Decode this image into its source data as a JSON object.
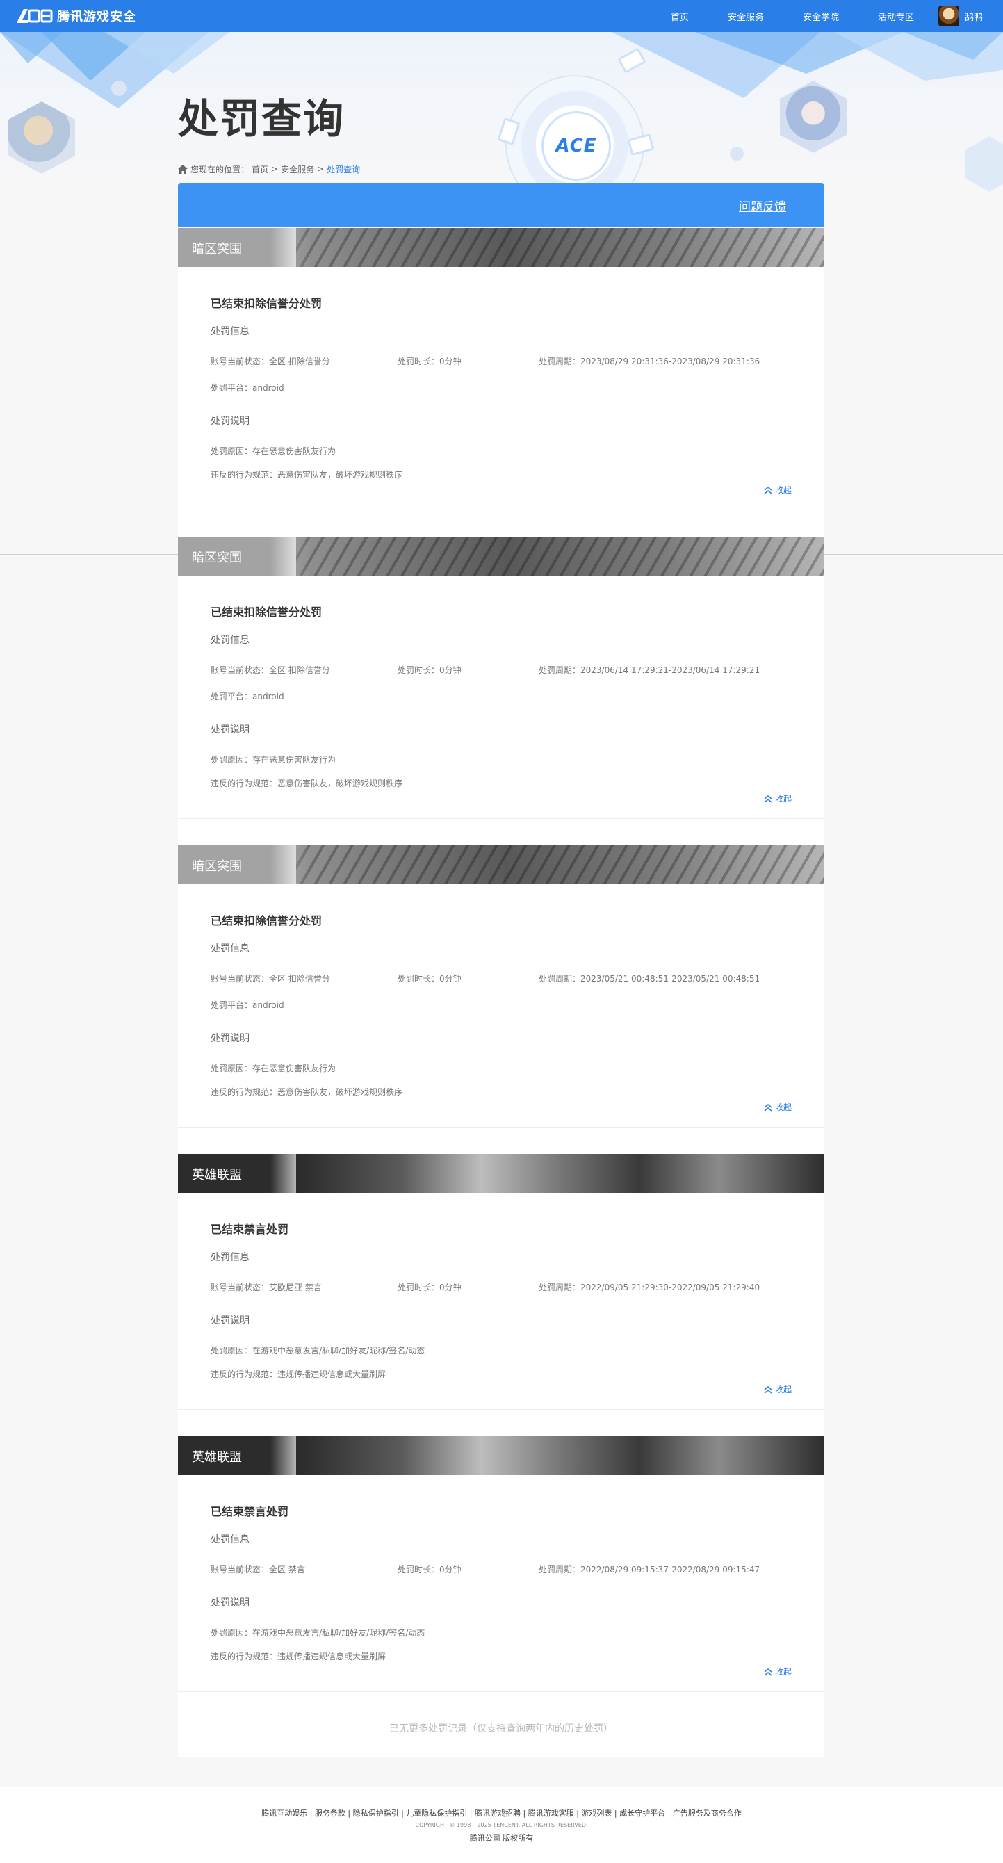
{
  "nav": {
    "logo_text": "腾讯游戏安全",
    "logo_mark": "ACE",
    "links": [
      "首页",
      "安全服务",
      "安全学院",
      "活动专区"
    ],
    "user_name": "鸹鸭"
  },
  "hero": {
    "title": "处罚查询",
    "ace_mark": "ACE"
  },
  "breadcrumb": {
    "prefix": "您现在的位置：",
    "items": [
      "首页",
      "安全服务"
    ],
    "separator": ">",
    "current": "处罚查询"
  },
  "feedback": {
    "label": "问题反馈"
  },
  "labels": {
    "info_section": "处罚信息",
    "desc_section": "处罚说明",
    "status_prefix": "账号当前状态：",
    "duration_prefix": "处罚时长：",
    "period_prefix": "处罚周期：",
    "platform_prefix": "处罚平台：",
    "reason_prefix": "处罚原因：",
    "rule_prefix": "违反的行为规范：",
    "collapse": "收起"
  },
  "records": [
    {
      "game": "暗区突围",
      "title": "已结束扣除信誉分处罚",
      "status": "全区 扣除信誉分",
      "duration": "0分钟",
      "period": "2023/08/29 20:31:36-2023/08/29 20:31:36",
      "platform": "android",
      "reason": "存在恶意伤害队友行为",
      "rule": "恶意伤害队友，破坏游戏规则秩序"
    },
    {
      "game": "暗区突围",
      "title": "已结束扣除信誉分处罚",
      "status": "全区 扣除信誉分",
      "duration": "0分钟",
      "period": "2023/06/14 17:29:21-2023/06/14 17:29:21",
      "platform": "android",
      "reason": "存在恶意伤害队友行为",
      "rule": "恶意伤害队友，破坏游戏规则秩序"
    },
    {
      "game": "暗区突围",
      "title": "已结束扣除信誉分处罚",
      "status": "全区 扣除信誉分",
      "duration": "0分钟",
      "period": "2023/05/21 00:48:51-2023/05/21 00:48:51",
      "platform": "android",
      "reason": "存在恶意伤害队友行为",
      "rule": "恶意伤害队友，破坏游戏规则秩序"
    },
    {
      "game": "英雄联盟",
      "title": "已结束禁言处罚",
      "status": "艾欧尼亚 禁言",
      "duration": "0分钟",
      "period": "2022/09/05 21:29:30-2022/09/05 21:29:40",
      "platform": "",
      "reason": "在游戏中恶意发言/私聊/加好友/昵称/签名/动态",
      "rule": "违规传播违规信息或大量刷屏"
    },
    {
      "game": "英雄联盟",
      "title": "已结束禁言处罚",
      "status": "全区 禁言",
      "duration": "0分钟",
      "period": "2022/08/29 09:15:37-2022/08/29 09:15:47",
      "platform": "",
      "reason": "在游戏中恶意发言/私聊/加好友/昵称/签名/动态",
      "rule": "违规传播违规信息或大量刷屏"
    }
  ],
  "no_more": "已无更多处罚记录（仅支持查询两年内的历史处罚）",
  "footer": {
    "links": "腾讯互动娱乐 | 服务条款 | 隐私保护指引 | 儿童隐私保护指引 | 腾讯游戏招聘 | 腾讯游戏客服 | 游戏列表 | 成长守护平台 | 广告服务及商务合作",
    "copyright": "COPYRIGHT © 1998 – 2025 TENCENT. ALL RIGHTS RESERVED.",
    "corp": "腾讯公司 版权所有"
  }
}
